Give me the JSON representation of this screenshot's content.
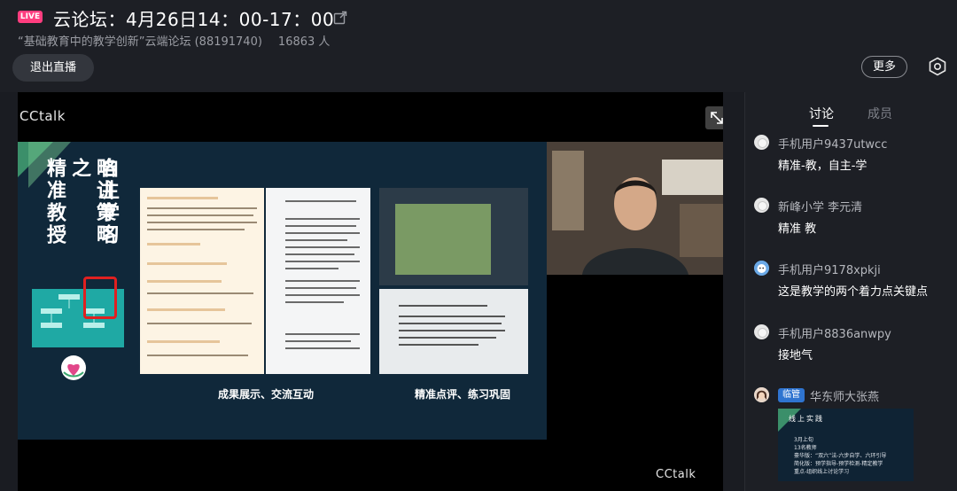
{
  "header": {
    "live_badge": "LIVE",
    "title": "云论坛：4月26日14：00-17：00",
    "forum_name": "“基础教育中的教学创新”云端论坛 (88191740)",
    "viewer_count": "16863 人",
    "exit_button": "退出直播",
    "more_button": "更多"
  },
  "video": {
    "brand_top": "CCtalk",
    "brand_bottom": "CCtalk",
    "slide": {
      "columns": [
        "略讲策略",
        "自主学习之",
        "精准教授"
      ],
      "caption_left": "成果展示、交流互动",
      "caption_right": "精准点评、练习巩固"
    }
  },
  "sidebar": {
    "tabs": [
      "讨论",
      "成员"
    ],
    "messages": [
      {
        "user": "手机用户9437utwcc",
        "text": "精准-教，自主-学"
      },
      {
        "user": "新峰小学 李元清",
        "text": "精准 教"
      },
      {
        "user": "手机用户9178xpkji",
        "text": "这是教学的两个着力点关键点"
      },
      {
        "user": "手机用户8836anwpy",
        "text": "接地气"
      },
      {
        "badge": "临管",
        "user": "华东师大张燕",
        "image": {
          "title": "线上实践",
          "lines": [
            "3月上旬",
            "13名教师",
            "豪华版：“双六”法-六步自学、六环引导",
            "简化版：预学指导-预学检测-精定教学",
            "重点-组织线上讨论学习"
          ]
        }
      }
    ]
  },
  "colors": {
    "live_badge": "#ff3d7f",
    "admin_badge": "#2f74d0",
    "slide_bg": "#10283a",
    "mindmap": "#1fa9a4",
    "highlight": "#e02020"
  }
}
